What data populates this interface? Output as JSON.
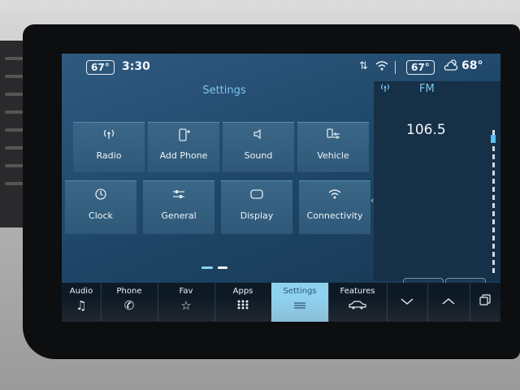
{
  "status": {
    "cabin_temp_left": "67°",
    "time": "3:30",
    "cabin_temp_right": "67°",
    "outside_temp": "68°"
  },
  "main": {
    "title": "Settings",
    "tiles": [
      {
        "label": "Radio",
        "icon": "radio-antenna-icon"
      },
      {
        "label": "Add Phone",
        "icon": "add-phone-icon"
      },
      {
        "label": "Sound",
        "icon": "speaker-icon"
      },
      {
        "label": "Vehicle",
        "icon": "vehicle-settings-icon"
      },
      {
        "label": "Clock",
        "icon": "clock-icon"
      },
      {
        "label": "General",
        "icon": "sliders-icon"
      },
      {
        "label": "Display",
        "icon": "display-icon"
      },
      {
        "label": "Connectivity",
        "icon": "wifi-icon"
      }
    ]
  },
  "radio_panel": {
    "band": "FM",
    "frequency": "106.5",
    "seek_back_icon": "seek-back-icon",
    "seek_forward_icon": "seek-forward-icon"
  },
  "bottom_nav": [
    {
      "label": "Audio",
      "icon": "music-note-icon"
    },
    {
      "label": "Phone",
      "icon": "phone-icon"
    },
    {
      "label": "Fav",
      "icon": "star-icon"
    },
    {
      "label": "Apps",
      "icon": "apps-grid-icon"
    },
    {
      "label": "Settings",
      "icon": "settings-list-icon",
      "active": true
    },
    {
      "label": "Features",
      "icon": "car-icon"
    },
    {
      "label": "",
      "icon": "chevron-down-icon"
    },
    {
      "label": "",
      "icon": "chevron-up-icon"
    },
    {
      "label": "",
      "icon": "copy-screens-icon"
    }
  ],
  "colors": {
    "accent": "#8fd2f0",
    "title": "#7ec6ee",
    "tile": "#35607f"
  }
}
